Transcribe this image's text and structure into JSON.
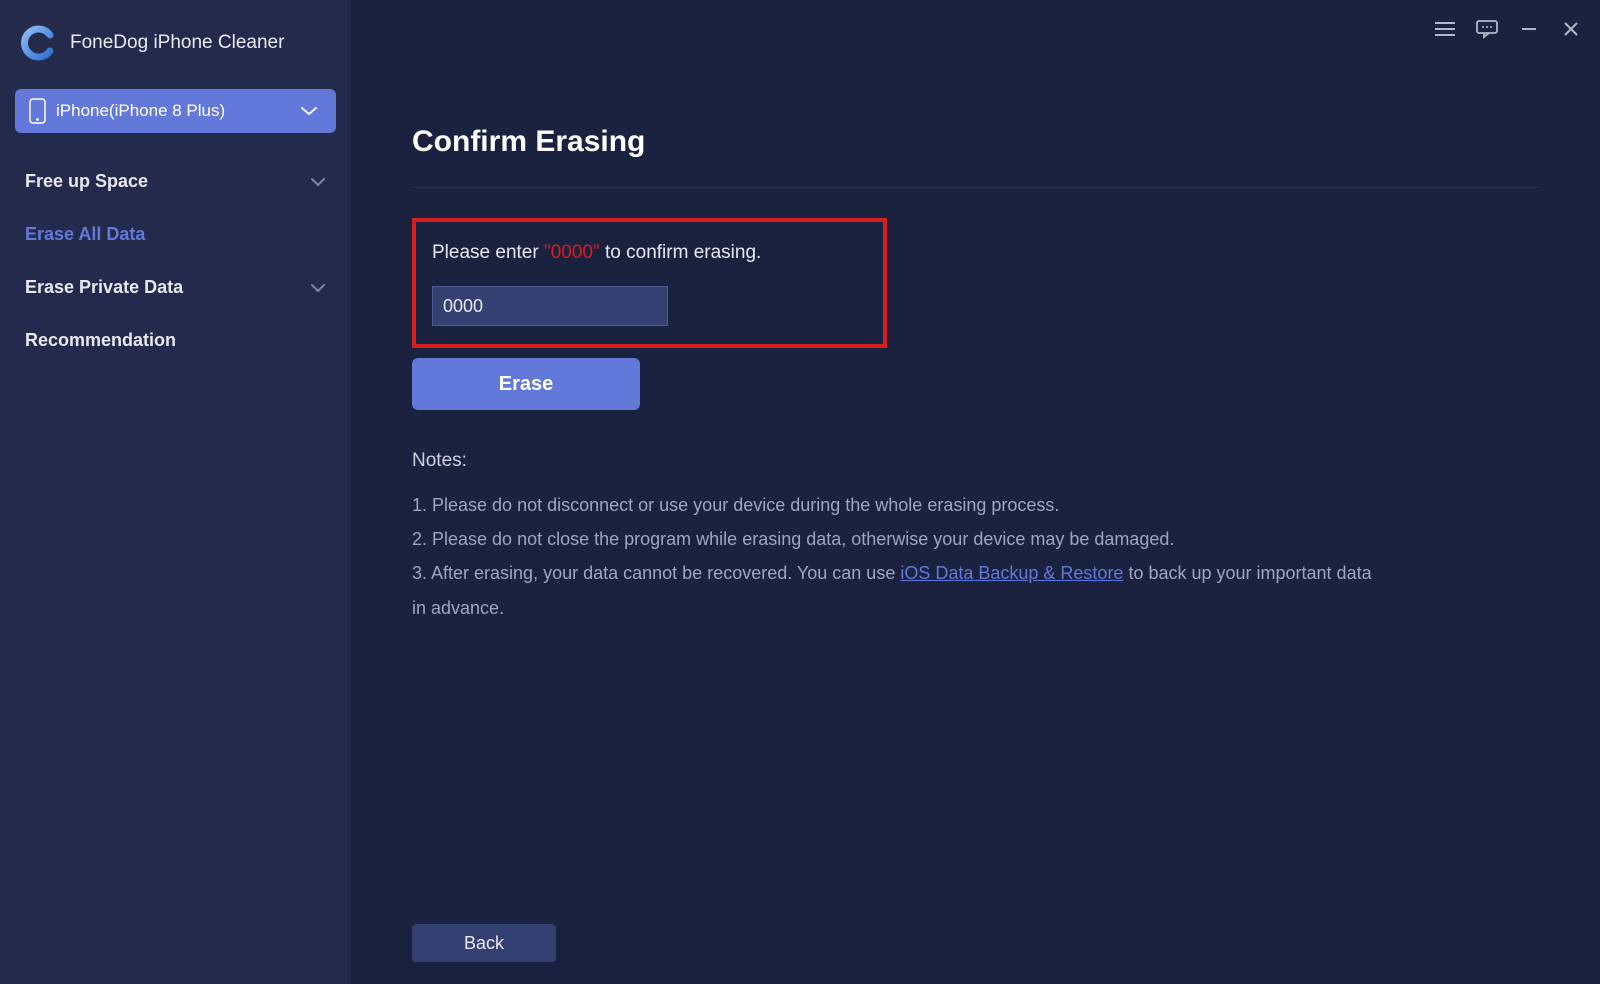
{
  "app": {
    "title": "FoneDog iPhone Cleaner"
  },
  "device": {
    "label": "iPhone(iPhone 8 Plus)"
  },
  "sidebar": {
    "items": [
      {
        "label": "Free up Space",
        "has_chevron": true,
        "active": false
      },
      {
        "label": "Erase All Data",
        "has_chevron": false,
        "active": true
      },
      {
        "label": "Erase Private Data",
        "has_chevron": true,
        "active": false
      },
      {
        "label": "Recommendation",
        "has_chevron": false,
        "active": false
      }
    ]
  },
  "main": {
    "page_title": "Confirm Erasing",
    "confirm_prefix": "Please enter ",
    "confirm_code": "\"0000\"",
    "confirm_suffix": " to confirm erasing.",
    "input_value": "0000",
    "erase_label": "Erase",
    "back_label": "Back",
    "notes_title": "Notes:",
    "note1": "1. Please do not disconnect or use your device during the whole erasing process.",
    "note2": "2. Please do not close the program while erasing data, otherwise your device may be damaged.",
    "note3_a": "3. After erasing, your data cannot be recovered. You can use ",
    "note3_link": "iOS Data Backup & Restore",
    "note3_b": " to back up your important data in advance."
  }
}
